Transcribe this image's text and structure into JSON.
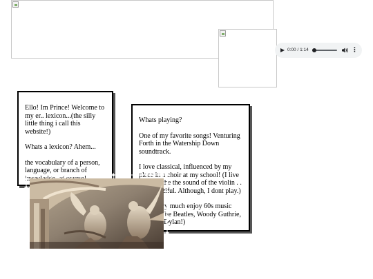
{
  "images": {
    "banner_alt": "",
    "small_alt": ""
  },
  "audio": {
    "time": "0:00 / 1:14",
    "progress": 0,
    "volume_icon": "volume-icon",
    "menu_icon": "more-vert-icon",
    "colors": {
      "bg": "#f1f3f4",
      "fg": "#202124"
    }
  },
  "box_left": {
    "p1": "Ello! Im Prince! Welcome to my er.. lexicon...(the silly little thing i call this website!)",
    "p2": "Whats a lexicon? Ahem...",
    "p3": "the vocabulary of a person, language, or branch of knowledge, of course!"
  },
  "box_right": {
    "p1": "Whats playing?",
    "p2": "One of my favorite songs! Venturing Forth in the Watership Down soundtrack.",
    "p3": "I love classical, influenced by my place in a choir at my school! (I live and breathe the sound of the violin . . . so beautiful. Although, I dont play.)",
    "p4": "I also very much enjoy 60s music such as The Beatles, Woody Guthrie, and Bob Dylan!)"
  },
  "stamp": {
    "subject": "baroque ceiling sculpture of angels"
  }
}
